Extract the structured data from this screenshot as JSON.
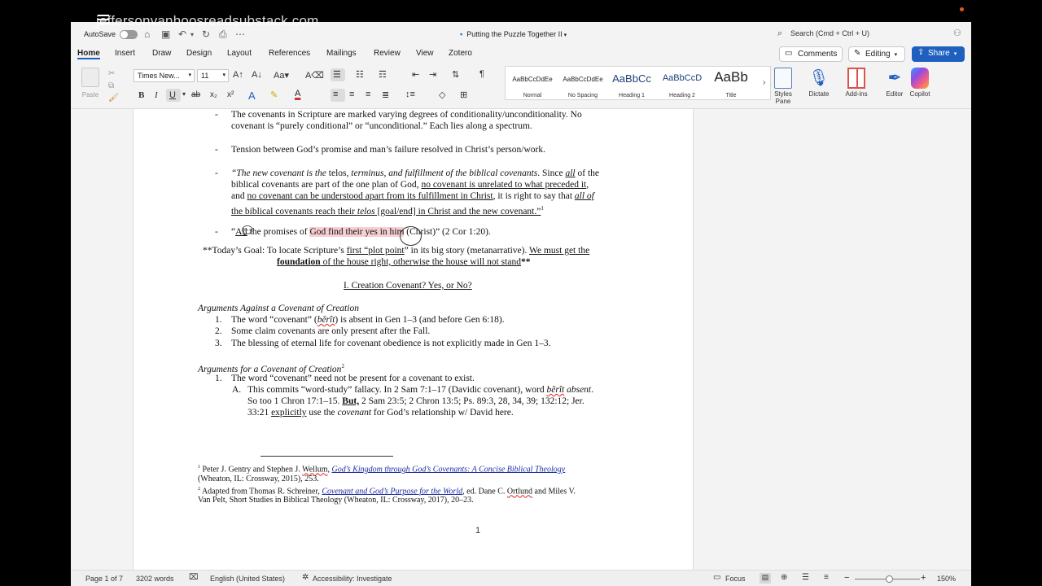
{
  "overlay": {
    "url": "jeffersonvanhoosreadsubstack.com"
  },
  "titlebar": {
    "autosave_label": "AutoSave",
    "doc_title": "Putting the Puzzle Together II",
    "search_placeholder": "Search (Cmd + Ctrl + U)"
  },
  "tabs": [
    "Home",
    "Insert",
    "Draw",
    "Design",
    "Layout",
    "References",
    "Mailings",
    "Review",
    "View",
    "Zotero"
  ],
  "actions": {
    "comments": "Comments",
    "editing": "Editing",
    "share": "Share"
  },
  "ribbon": {
    "paste_label": "Paste",
    "font_name": "Times New...",
    "font_size": "11",
    "styles": [
      {
        "sample": "AaBbCcDdEe",
        "name": "Normal"
      },
      {
        "sample": "AaBbCcDdEe",
        "name": "No Spacing"
      },
      {
        "sample": "AaBbCc",
        "name": "Heading 1"
      },
      {
        "sample": "AaBbCcD",
        "name": "Heading 2"
      },
      {
        "sample": "AaBb",
        "name": "Title"
      }
    ],
    "styles_pane": "Styles Pane",
    "dictate": "Dictate",
    "addins": "Add-ins",
    "editor": "Editor",
    "copilot": "Copilot"
  },
  "document": {
    "b1_l1": "The covenants in Scripture are marked varying degrees of conditionality/unconditionality. No",
    "b1_l2": "covenant is “purely conditional” or “unconditional.” Each lies along a spectrum.",
    "b2": "Tension between God’s promise and man’s failure resolved in Christ’s person/work.",
    "b3_l1a": "“The new covenant is the ",
    "b3_l1b": "telos",
    "b3_l1c": ", terminus, and fulfillment of the biblical covenants",
    "b3_l1d": ". Since ",
    "b3_l1e": "all",
    "b3_l1f": " of the",
    "b3_l2a": "biblical covenants are part of the one plan of God, ",
    "b3_l2b": "no covenant is unrelated to what preceded it",
    "b3_l2c": ",",
    "b3_l3a": "and ",
    "b3_l3b": "no covenant can be understood apart from its fulfillment in Christ",
    "b3_l3c": ", it is right to say that ",
    "b3_l3d": "all of",
    "b3_l4a": "the biblical covenants reach their ",
    "b3_l4b": "telos",
    "b3_l4c": " [goal/end] in Christ and the new covenant.”",
    "b3_fn": "1",
    "b4a": "“",
    "b4b": "All",
    "b4c": " the promises of ",
    "b4d": "God find their yes in him",
    "b4e": " (Christ)” (2 Cor 1:20).",
    "goal_l1a": "**Today’s Goal: To locate Scripture’s ",
    "goal_l1b": "first “plot point",
    "goal_l1c": "” in its big story (metanarrative). ",
    "goal_l1d": "We must get the",
    "goal_l2a": "foundation",
    "goal_l2b": " of the house right, otherwise the house will not stand",
    "goal_l2c": "**",
    "heading": "I. Creation Covenant? Yes, or No?",
    "against_title": "Arguments Against a Covenant of Creation",
    "against_1a": "The word “covenant” (",
    "against_1b": "bĕrît",
    "against_1c": ") is absent in Gen 1–3 (and before Gen 6:18).",
    "against_2": "Some claim covenants are only present after the Fall.",
    "against_3": "The blessing of eternal life for covenant obedience is not explicitly made in Gen 1–3.",
    "for_title": "Arguments for a Covenant of Creation",
    "for_fn": "2",
    "for_1": "The word “covenant” need not be present for a covenant to exist.",
    "for_A_l1a": "This commits “word-study” fallacy. In 2 Sam 7:1–17 (Davidic covenant), word ",
    "for_A_l1b": "bĕrît",
    "for_A_l1c": " absent",
    "for_A_l1d": ".",
    "for_A_l2a": "So too 1 Chron 17:1–15. ",
    "for_A_l2b": "But,",
    "for_A_l2c": " 2 Sam 23:5; 2 Chron 13:5; Ps. 89:3, 28, 34, 39; 132:12; Jer.",
    "for_A_l3a": "33:21 ",
    "for_A_l3b": "explicitly",
    "for_A_l3c": " use the ",
    "for_A_l3d": "covenant",
    "for_A_l3e": " for God’s relationship w/ David here.",
    "fn1_l1a": "Peter J. Gentry and Stephen J. ",
    "fn1_l1b": "Wellum",
    "fn1_l1c": ", ",
    "fn1_l1d": "God’s Kingdom through God’s Covenants: A Concise Biblical Theology",
    "fn1_l2": "(Wheaton, IL: Crossway, 2015), 253.",
    "fn2_l1a": "Adapted from Thomas R. Schreiner, ",
    "fn2_l1b": "Covenant and God’s Purpose for the World",
    "fn2_l1c": ", ed. Dane C. ",
    "fn2_l1d": "Ortlund",
    "fn2_l1e": " and Miles V.",
    "fn2_l2": "Van Pelt, Short Studies in Biblical Theology (Wheaton, IL: Crossway, 2017), 20–23.",
    "page_number": "1"
  },
  "status": {
    "page": "Page 1 of 7",
    "words": "3202 words",
    "language": "English (United States)",
    "accessibility": "Accessibility: Investigate",
    "focus": "Focus",
    "zoom": "150%"
  },
  "colors": {
    "accent": "#1f5fbf",
    "highlight": "#f6cfd3",
    "link": "#1a2aa0"
  }
}
